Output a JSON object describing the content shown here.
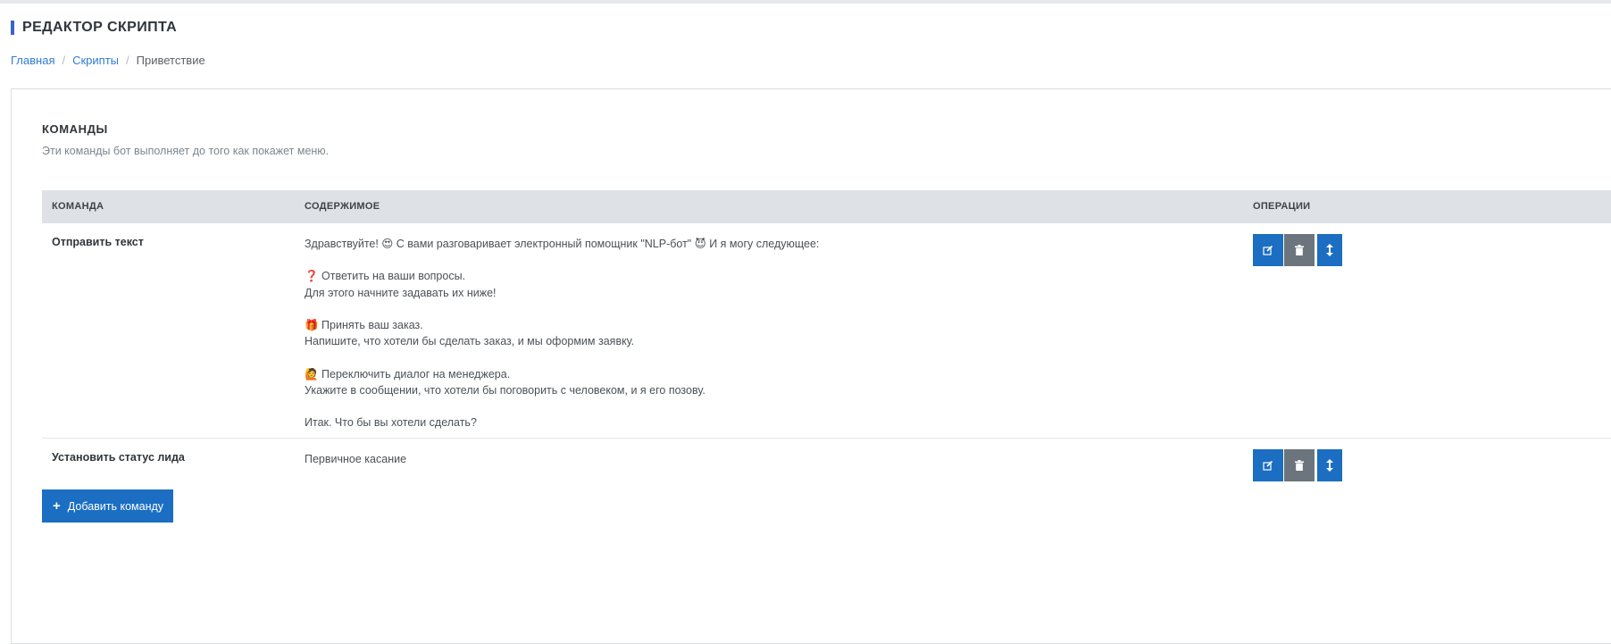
{
  "page": {
    "title": "РЕДАКТОР СКРИПТА"
  },
  "breadcrumb": {
    "home": "Главная",
    "scripts": "Скрипты",
    "current": "Приветствие",
    "separator": "/"
  },
  "section": {
    "title": "КОМАНДЫ",
    "subtitle": "Эти команды бот выполняет до того как покажет меню."
  },
  "table": {
    "headers": {
      "command": "КОМАНДА",
      "content": "СОДЕРЖИМОЕ",
      "operations": "ОПЕРАЦИИ"
    },
    "rows": [
      {
        "command": "Отправить текст",
        "content_lines": [
          "Здравствуйте! 😍 С вами разговаривает электронный помощник \"NLP-бот\" 😈 И я могу следующее:",
          "",
          "❓ Ответить на ваши вопросы.",
          "Для этого начните задавать их ниже!",
          "",
          "🎁 Принять ваш заказ.",
          "Напишите, что хотели бы сделать заказ, и мы оформим заявку.",
          "",
          "🙋 Переключить диалог на менеджера.",
          "Укажите в сообщении, что хотели бы поговорить с человеком, и я его позову.",
          "",
          "Итак. Что бы вы хотели сделать?"
        ]
      },
      {
        "command": "Установить статус лида",
        "content_lines": [
          "Первичное касание"
        ]
      }
    ]
  },
  "actions": {
    "edit_icon": "edit-icon",
    "delete_icon": "trash-icon",
    "move_icon": "vertical-arrows-icon",
    "add_command": "Добавить команду",
    "add_icon": "plus-icon"
  },
  "colors": {
    "accent": "#1b6ec2",
    "secondary": "#6c757d",
    "title_bar": "#3a63c8",
    "table_header": "#dee1e6"
  }
}
